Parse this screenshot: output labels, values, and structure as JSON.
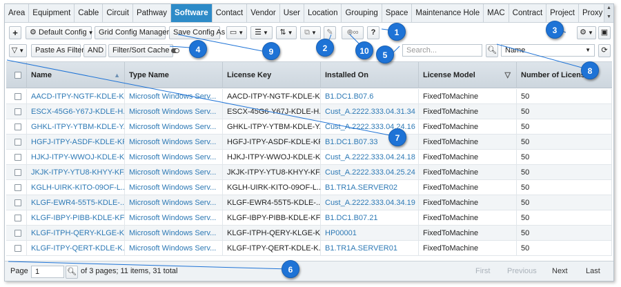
{
  "tabs": [
    "Area",
    "Equipment",
    "Cable",
    "Circuit",
    "Pathway",
    "Software",
    "Contact",
    "Vendor",
    "User",
    "Location",
    "Grouping",
    "Space",
    "Maintenance Hole",
    "MAC",
    "Contract",
    "Project",
    "Proxy"
  ],
  "active_tab": "Software",
  "toolbar": {
    "add_label": "+",
    "default_config_label": "Default Config",
    "grid_config_manager_label": "Grid Config Manager",
    "save_config_as_label": "Save Config As",
    "help_label": "?"
  },
  "filter_bar": {
    "paste_as_filter_label": "Paste As Filter",
    "and_label": "AND",
    "filter_sort_cache_label": "Filter/Sort Cache",
    "search_placeholder": "Search...",
    "search_field_value": "Name"
  },
  "grid": {
    "columns": [
      "Name",
      "Type Name",
      "License Key",
      "Installed On",
      "License Model",
      "Number of Licenses"
    ],
    "rows": [
      {
        "name": "AACD-ITPY-NGTF-KDLE-K...",
        "type_name": "Microsoft Windows Serv...",
        "license_key": "AACD-ITPY-NGTF-KDLE-K...",
        "installed_on": "B1.DC1.B07.6",
        "license_model": "FixedToMachine",
        "num_licenses": "50"
      },
      {
        "name": "ESCX-45G6-Y67J-KDLE-H...",
        "type_name": "Microsoft Windows Serv...",
        "license_key": "ESCX-45G6-Y67J-KDLE-H...",
        "installed_on": "Cust_A.2222.333.04.31.34",
        "license_model": "FixedToMachine",
        "num_licenses": "50"
      },
      {
        "name": "GHKL-ITPY-YTBM-KDLE-Y...",
        "type_name": "Microsoft Windows Serv...",
        "license_key": "GHKL-ITPY-YTBM-KDLE-Y...",
        "installed_on": "Cust_A.2222.333.04.24.16",
        "license_model": "FixedToMachine",
        "num_licenses": "50"
      },
      {
        "name": "HGFJ-ITPY-ASDF-KDLE-KF...",
        "type_name": "Microsoft Windows Serv...",
        "license_key": "HGFJ-ITPY-ASDF-KDLE-KF...",
        "installed_on": "B1.DC1.B07.33",
        "license_model": "FixedToMachine",
        "num_licenses": "50"
      },
      {
        "name": "HJKJ-ITPY-WWOJ-KDLE-K...",
        "type_name": "Microsoft Windows Serv...",
        "license_key": "HJKJ-ITPY-WWOJ-KDLE-K...",
        "installed_on": "Cust_A.2222.333.04.24.18",
        "license_model": "FixedToMachine",
        "num_licenses": "50"
      },
      {
        "name": "JKJK-ITPY-YTU8-KHYY-KF...",
        "type_name": "Microsoft Windows Serv...",
        "license_key": "JKJK-ITPY-YTU8-KHYY-KF...",
        "installed_on": "Cust_A.2222.333.04.25.24",
        "license_model": "FixedToMachine",
        "num_licenses": "50"
      },
      {
        "name": "KGLH-UIRK-KITO-09OF-L...",
        "type_name": "Microsoft Windows Serv...",
        "license_key": "KGLH-UIRK-KITO-09OF-L...",
        "installed_on": "B1.TR1A.SERVER02",
        "license_model": "FixedToMachine",
        "num_licenses": "50"
      },
      {
        "name": "KLGF-EWR4-55T5-KDLE-...",
        "type_name": "Microsoft Windows Serv...",
        "license_key": "KLGF-EWR4-55T5-KDLE-...",
        "installed_on": "Cust_A.2222.333.04.34.19",
        "license_model": "FixedToMachine",
        "num_licenses": "50"
      },
      {
        "name": "KLGF-IBPY-PIBB-KDLE-KF...",
        "type_name": "Microsoft Windows Serv...",
        "license_key": "KLGF-IBPY-PIBB-KDLE-KF...",
        "installed_on": "B1.DC1.B07.21",
        "license_model": "FixedToMachine",
        "num_licenses": "50"
      },
      {
        "name": "KLGF-ITPH-QERY-KLGE-K...",
        "type_name": "Microsoft Windows Serv...",
        "license_key": "KLGF-ITPH-QERY-KLGE-K...",
        "installed_on": "HP00001",
        "license_model": "FixedToMachine",
        "num_licenses": "50"
      },
      {
        "name": "KLGF-ITPY-QERT-KDLE-K...",
        "type_name": "Microsoft Windows Serv...",
        "license_key": "KLGF-ITPY-QERT-KDLE-K...",
        "installed_on": "B1.TR1A.SERVER01",
        "license_model": "FixedToMachine",
        "num_licenses": "50"
      }
    ]
  },
  "footer": {
    "page_label": "Page",
    "page_value": "1",
    "summary": "of 3 pages; 11 items, 31 total",
    "first": "First",
    "previous": "Previous",
    "next": "Next",
    "last": "Last"
  },
  "callouts": [
    "1",
    "2",
    "3",
    "4",
    "5",
    "6",
    "7",
    "8",
    "9",
    "10"
  ],
  "colors": {
    "active_tab": "#2d8bc8",
    "link": "#2d79b5",
    "callout": "#1e73d6"
  }
}
